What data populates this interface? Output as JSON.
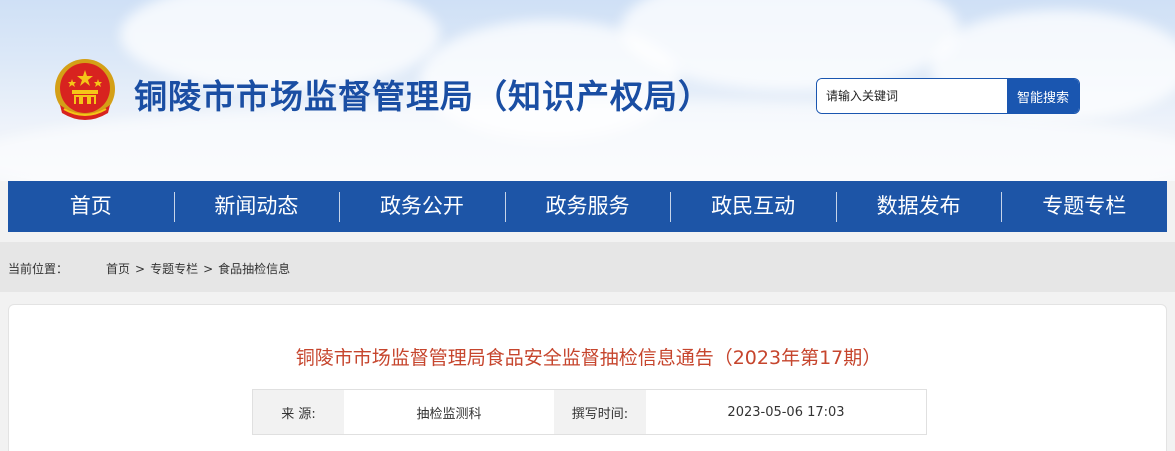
{
  "site": {
    "title": "铜陵市市场监督管理局（知识产权局）"
  },
  "search": {
    "placeholder": "请输入关键词",
    "button_label": "智能搜索"
  },
  "nav": {
    "items": [
      {
        "label": "首页"
      },
      {
        "label": "新闻动态"
      },
      {
        "label": "政务公开"
      },
      {
        "label": "政务服务"
      },
      {
        "label": "政民互动"
      },
      {
        "label": "数据发布"
      },
      {
        "label": "专题专栏"
      }
    ]
  },
  "breadcrumb": {
    "label": "当前位置：",
    "items": [
      {
        "label": "首页"
      },
      {
        "label": "专题专栏"
      },
      {
        "label": "食品抽检信息"
      }
    ],
    "separator": ">"
  },
  "article": {
    "title": "铜陵市市场监督管理局食品安全监督抽检信息通告（2023年第17期）",
    "source_label": "来 源:",
    "source_value": "抽检监测科",
    "time_label": "撰写时间:",
    "time_value": "2023-05-06 17:03"
  },
  "colors": {
    "brand_blue": "#1d55a7",
    "title_red": "#c6452d"
  }
}
